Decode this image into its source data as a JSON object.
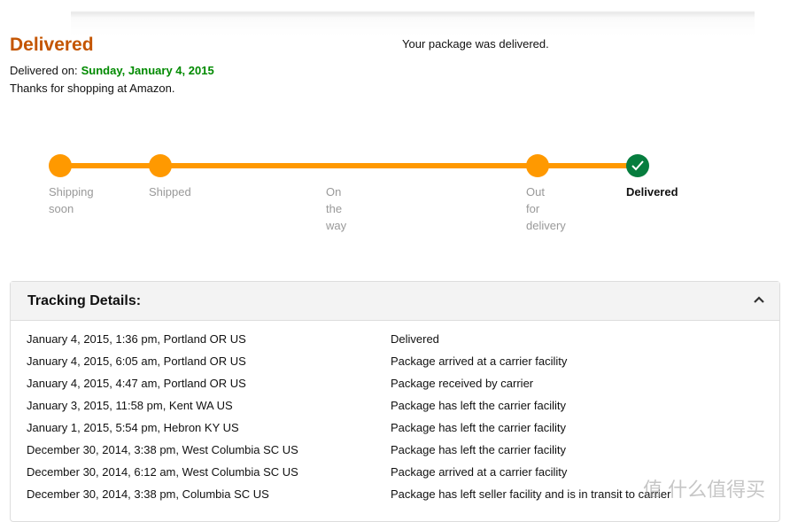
{
  "header": {
    "title": "Delivered",
    "message": "Your package was delivered.",
    "delivered_on_label": "Delivered on:",
    "delivered_on_date": "Sunday, January 4, 2015",
    "thanks": "Thanks for shopping at Amazon."
  },
  "progress": {
    "steps": [
      {
        "label": "Shipping\nsoon",
        "reached": true
      },
      {
        "label": "Shipped",
        "reached": true
      },
      {
        "label": "On\nthe\nway",
        "reached": false
      },
      {
        "label": "Out\nfor\ndelivery",
        "reached": true
      },
      {
        "label": "Delivered",
        "reached": true,
        "current": true
      }
    ],
    "accent": "#ff9900",
    "done_color": "#067d3e"
  },
  "tracking": {
    "title": "Tracking Details:",
    "rows": [
      {
        "when": "January 4, 2015, 1:36 pm, Portland OR US",
        "event": "Delivered"
      },
      {
        "when": "January 4, 2015, 6:05 am, Portland OR US",
        "event": "Package arrived at a carrier facility"
      },
      {
        "when": "January 4, 2015, 4:47 am, Portland OR US",
        "event": "Package received by carrier"
      },
      {
        "when": "January 3, 2015, 11:58 pm, Kent WA US",
        "event": "Package has left the carrier facility"
      },
      {
        "when": "January 1, 2015, 5:54 pm, Hebron KY US",
        "event": "Package has left the carrier facility"
      },
      {
        "when": "December 30, 2014, 3:38 pm, West Columbia SC US",
        "event": "Package has left the carrier facility"
      },
      {
        "when": "December 30, 2014, 6:12 am, West Columbia SC US",
        "event": "Package arrived at a carrier facility"
      },
      {
        "when": "December 30, 2014, 3:38 pm, Columbia SC US",
        "event": "Package has left seller facility and is in transit to carrier"
      }
    ]
  },
  "watermark": "值 什么值得买"
}
